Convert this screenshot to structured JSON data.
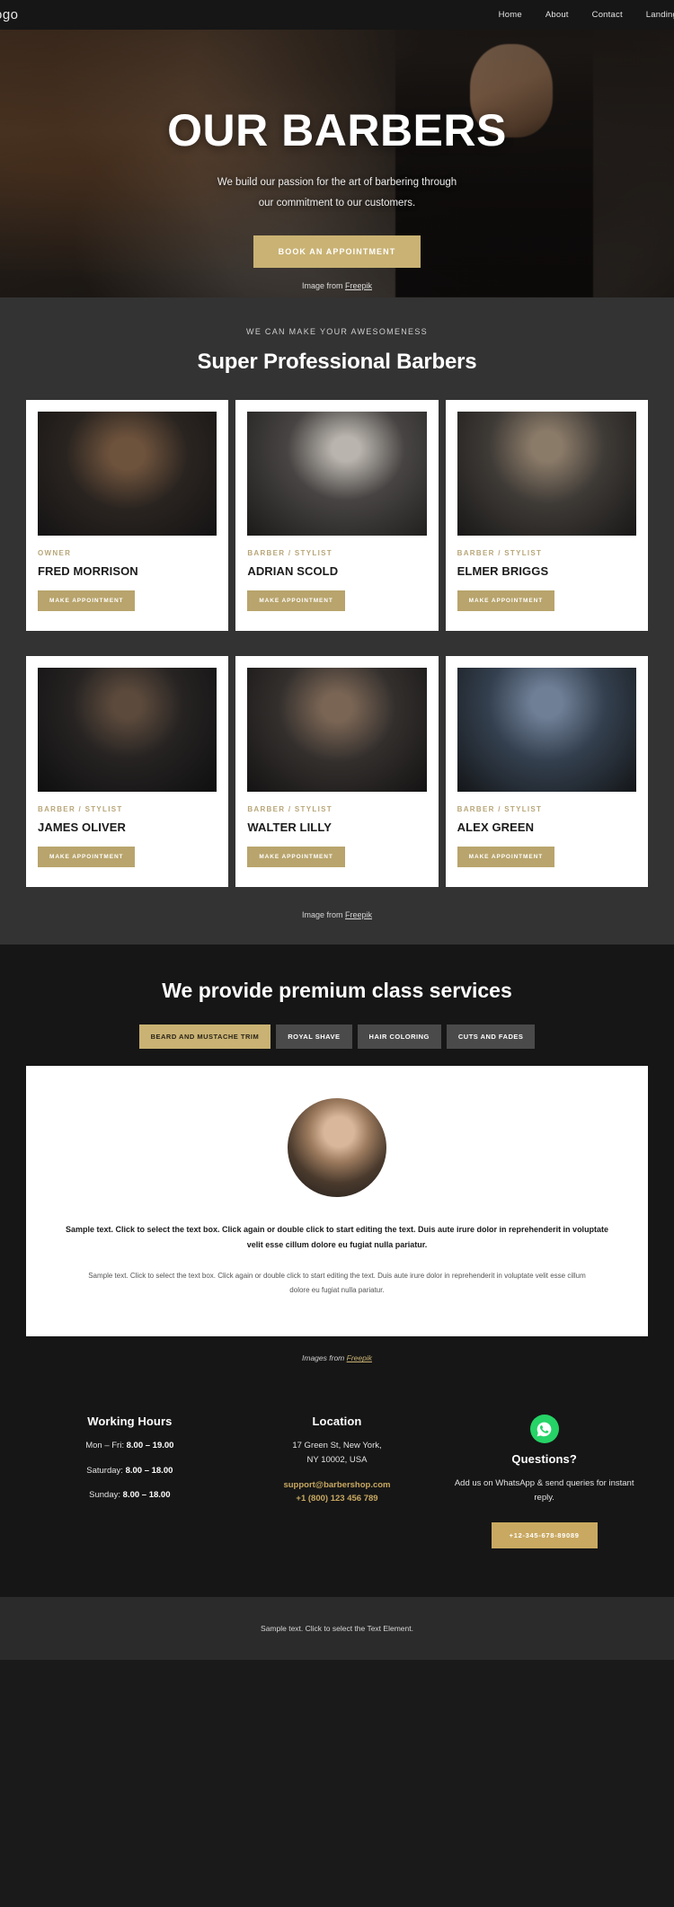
{
  "header": {
    "logo": "ogo",
    "nav": [
      {
        "label": "Home"
      },
      {
        "label": "About"
      },
      {
        "label": "Contact"
      },
      {
        "label": "Landing"
      }
    ]
  },
  "hero": {
    "title": "OUR BARBERS",
    "subtitle_line1": "We build our passion for the art of barbering through",
    "subtitle_line2": "our commitment to our customers.",
    "cta": "BOOK AN APPOINTMENT",
    "credit_prefix": "Image from ",
    "credit_link": "Freepik"
  },
  "barbers_section": {
    "eyebrow": "WE CAN MAKE YOUR AWESOMENESS",
    "title": "Super Professional Barbers",
    "button_label": "MAKE APPOINTMENT",
    "credit_prefix": "Image from ",
    "credit_link": "Freepik",
    "cards": [
      {
        "role": "OWNER",
        "name": "FRED MORRISON"
      },
      {
        "role": "BARBER / STYLIST",
        "name": "ADRIAN SCOLD"
      },
      {
        "role": "BARBER / STYLIST",
        "name": "ELMER BRIGGS"
      },
      {
        "role": "BARBER / STYLIST",
        "name": "JAMES OLIVER"
      },
      {
        "role": "BARBER / STYLIST",
        "name": "WALTER LILLY"
      },
      {
        "role": "BARBER / STYLIST",
        "name": "ALEX GREEN"
      }
    ]
  },
  "services": {
    "title": "We provide premium class services",
    "tabs": [
      {
        "label": "BEARD AND MUSTACHE TRIM",
        "active": true
      },
      {
        "label": "ROYAL SHAVE",
        "active": false
      },
      {
        "label": "HAIR COLORING",
        "active": false
      },
      {
        "label": "CUTS AND FADES",
        "active": false
      }
    ],
    "panel_lead": "Sample text. Click to select the text box. Click again or double click to start editing the text. Duis aute irure dolor in reprehenderit in voluptate velit esse cillum dolore eu fugiat nulla pariatur.",
    "panel_body": "Sample text. Click to select the text box. Click again or double click to start editing the text. Duis aute irure dolor in reprehenderit in voluptate velit esse cillum dolore eu fugiat nulla pariatur.",
    "credit_prefix": "Images from ",
    "credit_link": "Freepik"
  },
  "info": {
    "hours": {
      "title": "Working Hours",
      "rows": [
        {
          "label": "Mon – Fri: ",
          "value": "8.00 – 19.00"
        },
        {
          "label": "Saturday: ",
          "value": "8.00 – 18.00"
        },
        {
          "label": "Sunday: ",
          "value": "8.00 – 18.00"
        }
      ]
    },
    "location": {
      "title": "Location",
      "address_line1": "17 Green St, New York,",
      "address_line2": "NY 10002, USA",
      "email": "support@barbershop.com",
      "phone": "+1 (800) 123 456 789"
    },
    "questions": {
      "icon": "whatsapp-icon",
      "title": "Questions?",
      "text": "Add us on WhatsApp & send queries for instant reply.",
      "button": "+12-345-678-89089"
    }
  },
  "footer": {
    "text": "Sample text. Click to select the Text Element."
  },
  "colors": {
    "gold": "#c9b273",
    "gold_dark": "#b8a46c",
    "gold_link": "#c9a961",
    "whatsapp": "#25d366",
    "bg_dark": "#161616",
    "bg_mid": "#333333"
  }
}
